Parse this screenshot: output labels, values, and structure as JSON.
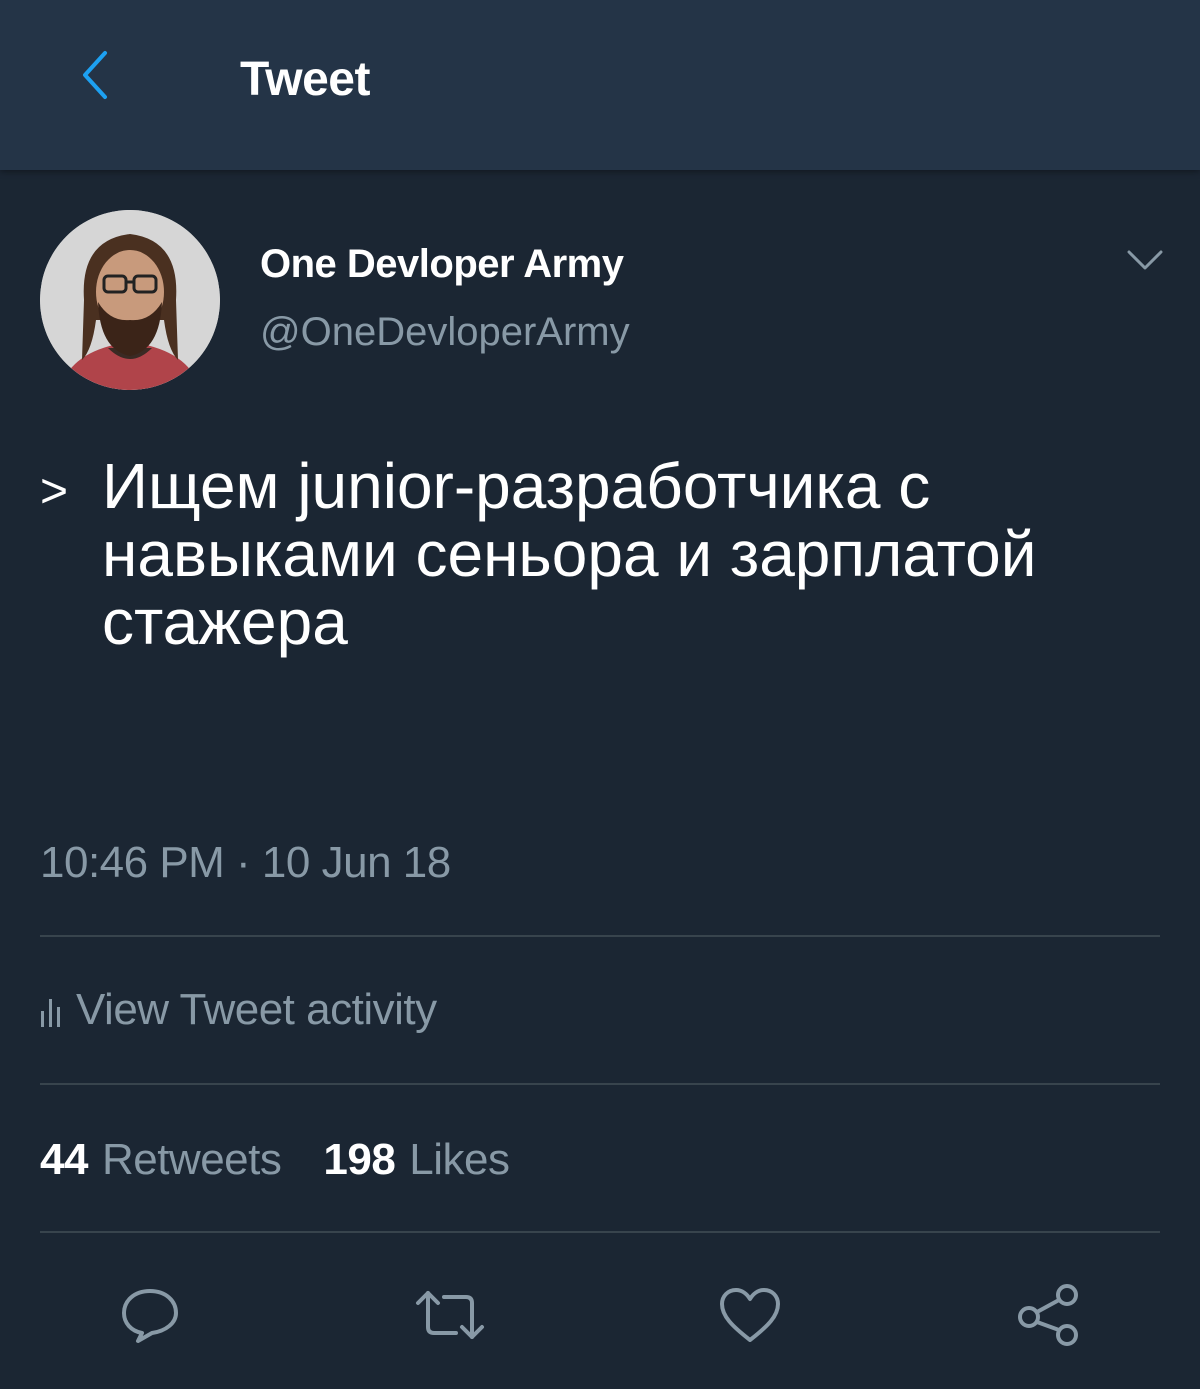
{
  "header": {
    "title": "Tweet",
    "back_icon": "chevron-left-icon"
  },
  "author": {
    "display_name": "One Devloper Army",
    "handle": "@OneDevloperArmy",
    "avatar_icon": "avatar-photo"
  },
  "tweet": {
    "quote_mark": ">",
    "text": "Ищем junior-разработчика с навыками сеньора и зарплатой стажера",
    "timestamp": "10:46 PM · 10 Jun 18"
  },
  "activity": {
    "label": "View Tweet activity",
    "icon": "bar-chart-icon"
  },
  "stats": {
    "retweets_count": "44",
    "retweets_label": "Retweets",
    "likes_count": "198",
    "likes_label": "Likes"
  },
  "actions": {
    "reply_icon": "reply-icon",
    "retweet_icon": "retweet-icon",
    "like_icon": "heart-icon",
    "share_icon": "share-icon"
  },
  "colors": {
    "background": "#1b2633",
    "topbar": "#243447",
    "accent": "#1da1f2",
    "secondary_text": "#8899a6",
    "divider": "#38444d"
  }
}
